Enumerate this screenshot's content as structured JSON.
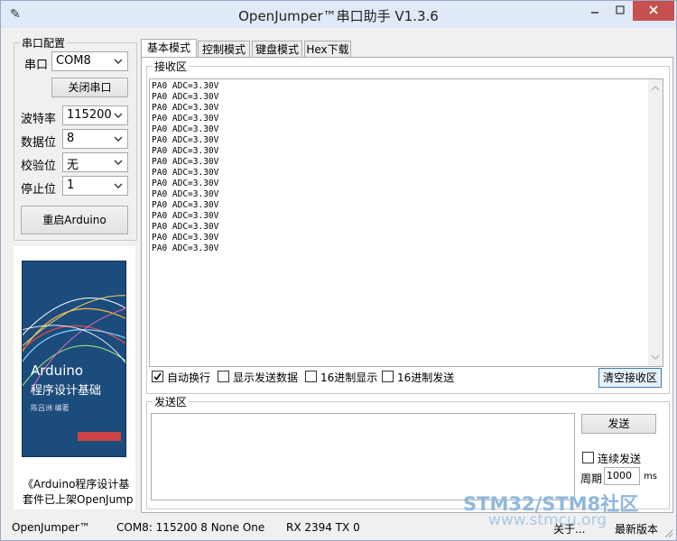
{
  "window": {
    "title": "OpenJumper™串口助手  V1.3.6"
  },
  "serial": {
    "group_title": "串口配置",
    "port_label": "串口",
    "port_value": "COM8",
    "close_button": "关闭串口",
    "baud_label": "波特率",
    "baud_value": "115200",
    "databits_label": "数据位",
    "databits_value": "8",
    "parity_label": "校验位",
    "parity_value": "无",
    "stopbits_label": "停止位",
    "stopbits_value": "1",
    "restart_button": "重启Arduino"
  },
  "book": {
    "title_en": "Arduino",
    "title_cn": "程序设计基础",
    "author": "陈吕洲    编著",
    "caption_line1": "《Arduino程序设计基",
    "caption_line2": "套件已上架OpenJump"
  },
  "tabs": [
    {
      "label": "基本模式",
      "active": true
    },
    {
      "label": "控制模式",
      "active": false
    },
    {
      "label": "键盘模式",
      "active": false
    },
    {
      "label": "Hex下载",
      "active": false
    }
  ],
  "receive": {
    "group_title": "接收区",
    "lines": [
      "PA0 ADC=3.30V",
      "PA0 ADC=3.30V",
      "PA0 ADC=3.30V",
      "PA0 ADC=3.30V",
      "PA0 ADC=3.30V",
      "PA0 ADC=3.30V",
      "PA0 ADC=3.30V",
      "PA0 ADC=3.30V",
      "PA0 ADC=3.30V",
      "PA0 ADC=3.30V",
      "PA0 ADC=3.30V",
      "PA0 ADC=3.30V",
      "PA0 ADC=3.30V",
      "PA0 ADC=3.30V",
      "PA0 ADC=3.30V",
      "PA0 ADC=3.30V"
    ],
    "auto_newline": "自动换行",
    "auto_newline_checked": true,
    "show_sent": "显示发送数据",
    "hex_display": "16进制显示",
    "hex_send": "16进制发送",
    "clear_button": "清空接收区"
  },
  "send": {
    "group_title": "发送区",
    "send_button": "发送",
    "continuous_label": "连续发送",
    "period_label": "周期",
    "period_value": "1000",
    "period_unit": "ms"
  },
  "status": {
    "brand": "OpenJumper™",
    "config": "COM8: 115200 8 None One",
    "rx_tx": "RX  2394  TX  0",
    "about": "关于...",
    "latest": "最新版本"
  },
  "watermark": {
    "line1": "STM32/STM8社区",
    "line2": "www.stmcu.org"
  },
  "colors": {
    "book_cover": "#1c4c7c",
    "accent_border": "#3c7fb1",
    "watermark": "#8fb8dc"
  }
}
